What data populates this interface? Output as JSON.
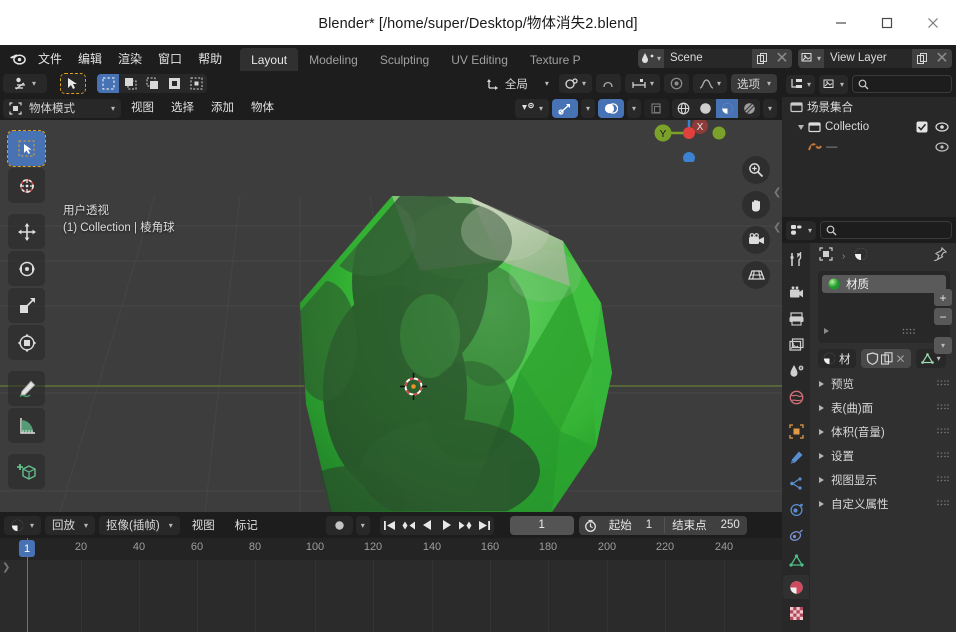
{
  "window": {
    "title": "Blender* [/home/super/Desktop/物体消失2.blend]",
    "minimize": "−",
    "maximize": "□",
    "close": "✕"
  },
  "topbar": {
    "menus": [
      "文件",
      "编辑",
      "渲染",
      "窗口",
      "帮助"
    ],
    "workspace_tabs": [
      {
        "label": "Layout",
        "active": true
      },
      {
        "label": "Modeling",
        "active": false
      },
      {
        "label": "Sculpting",
        "active": false
      },
      {
        "label": "UV Editing",
        "active": false
      },
      {
        "label": "Texture P",
        "active": false
      }
    ],
    "scene_field": {
      "name": "Scene",
      "new_btn": "copy-icon",
      "unlink_btn": "✕"
    },
    "viewlayer_field": {
      "name": "View Layer",
      "new_btn": "copy-icon",
      "unlink_btn": "✕"
    }
  },
  "tool_header": {
    "transform_orientation": "全局",
    "options_label": "选项"
  },
  "viewport_header": {
    "mode": "物体模式",
    "menus": [
      "视图",
      "选择",
      "添加",
      "物体"
    ]
  },
  "viewport": {
    "overlay_line1": "用户透视",
    "overlay_line2": "(1) Collection | 棱角球",
    "gizmo": {
      "z": "Z",
      "y": "Y",
      "x": "X"
    },
    "object_color": "#35b635",
    "bg_color": "#3d3d3d"
  },
  "toolbar": {
    "tools": [
      {
        "name": "select-box-tool",
        "active": true
      },
      {
        "name": "cursor-tool",
        "active": false
      },
      {
        "name": "move-tool",
        "active": false
      },
      {
        "name": "rotate-tool",
        "active": false
      },
      {
        "name": "scale-tool",
        "active": false
      },
      {
        "name": "transform-tool",
        "active": false
      },
      {
        "name": "annotate-tool",
        "active": false
      },
      {
        "name": "measure-tool",
        "active": false
      },
      {
        "name": "add-cube-tool",
        "active": false
      }
    ]
  },
  "outliner": {
    "scene_collection": "场景集合",
    "collection": "Collectio"
  },
  "properties": {
    "material_slot": "材质",
    "material_name_short": "材",
    "add_btn": "+",
    "remove_btn": "−",
    "panels": [
      "预览",
      "表(曲)面",
      "体积(音量)",
      "设置",
      "视图显示",
      "自定义属性"
    ],
    "active_tab": "material-properties-tab"
  },
  "timeline": {
    "menus": [
      "视图",
      "标记"
    ],
    "playback_label": "回放",
    "keying_label": "抠像(插帧)",
    "current_frame": "1",
    "start_label": "起始",
    "start_value": "1",
    "end_label": "结束点",
    "end_value": "250",
    "playhead_label": "1",
    "ruler_ticks": [
      "20",
      "40",
      "60",
      "80",
      "100",
      "120",
      "140",
      "160",
      "180",
      "200",
      "220",
      "240"
    ]
  }
}
